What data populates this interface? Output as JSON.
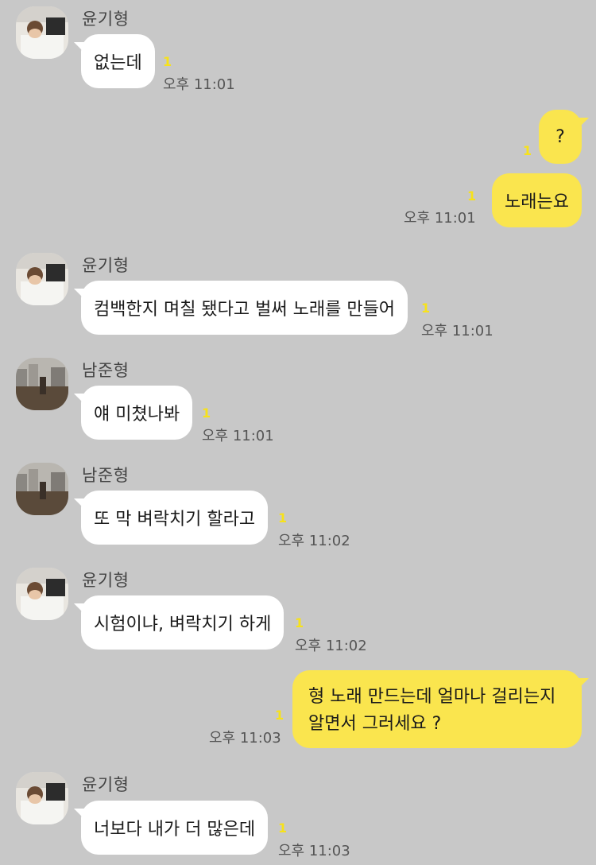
{
  "contacts": {
    "yoongi": "윤기형",
    "namjoon": "남준형"
  },
  "unread_marker": "1",
  "messages": [
    {
      "text": "없는데",
      "time": "오후 11:01"
    },
    {
      "text": "?"
    },
    {
      "text": "노래는요",
      "time": "오후 11:01"
    },
    {
      "text": "컴백한지 며칠 됐다고 벌써 노래를 만들어",
      "time": "오후 11:01"
    },
    {
      "text": "얘 미쳤나봐",
      "time": "오후 11:01"
    },
    {
      "text": "또 막 벼락치기 할라고",
      "time": "오후 11:02"
    },
    {
      "text": "시험이냐, 벼락치기 하게",
      "time": "오후 11:02"
    },
    {
      "line1": "형 노래 만드는데 얼마나 걸리는지",
      "line2": "알면서 그러세요 ?",
      "time": "오후 11:03"
    },
    {
      "text": "너보다 내가 더 많은데",
      "time": "오후 11:03"
    }
  ],
  "colors": {
    "background": "#c8c8c8",
    "my_bubble": "#fae54e",
    "their_bubble": "#ffffff",
    "unread": "#f7e21a"
  }
}
